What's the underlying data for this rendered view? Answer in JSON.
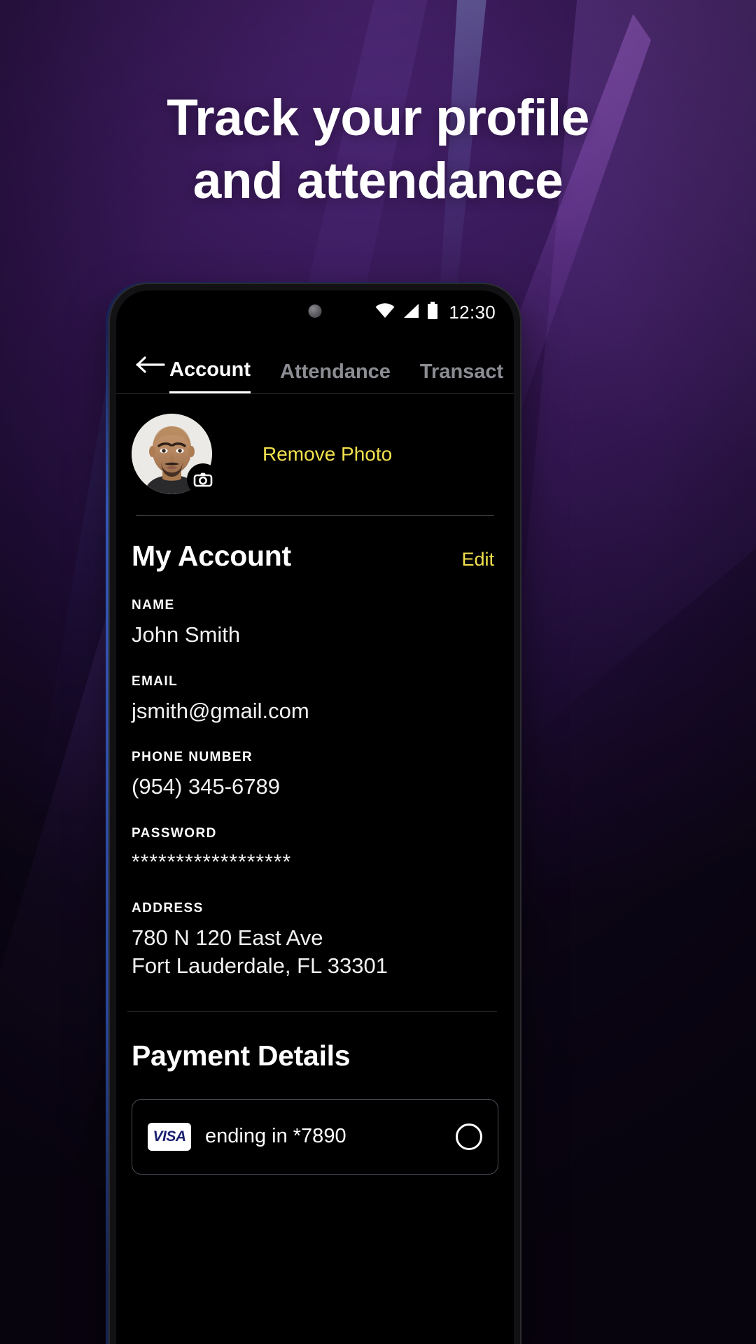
{
  "promo": {
    "headline_line1": "Track your profile",
    "headline_line2": "and attendance",
    "background_color": "#2a1145",
    "accent_color": "#F2E14C"
  },
  "phone": {
    "status_bar": {
      "time": "12:30",
      "icons": [
        "wifi-icon",
        "signal-icon",
        "battery-icon"
      ]
    },
    "nav": {
      "back_icon": "back-arrow-icon",
      "tabs": [
        {
          "label": "Account",
          "active": true
        },
        {
          "label": "Attendance",
          "active": false
        },
        {
          "label": "Transact",
          "active": false
        }
      ]
    },
    "profile": {
      "avatar_alt": "user-avatar",
      "camera_badge_icon": "camera-icon",
      "remove_photo_label": "Remove Photo"
    },
    "account": {
      "title": "My Account",
      "edit_label": "Edit",
      "fields": [
        {
          "label": "NAME",
          "value": "John Smith"
        },
        {
          "label": "EMAIL",
          "value": "jsmith@gmail.com"
        },
        {
          "label": "PHONE NUMBER",
          "value": "(954) 345-6789"
        },
        {
          "label": "PASSWORD",
          "value": "******************"
        }
      ],
      "address_label": "ADDRESS",
      "address_line1": "780 N 120 East Ave",
      "address_line2": "Fort Lauderdale, FL 33301"
    },
    "payment": {
      "title": "Payment Details",
      "card_brand": "VISA",
      "card_label": "ending in *7890"
    }
  }
}
